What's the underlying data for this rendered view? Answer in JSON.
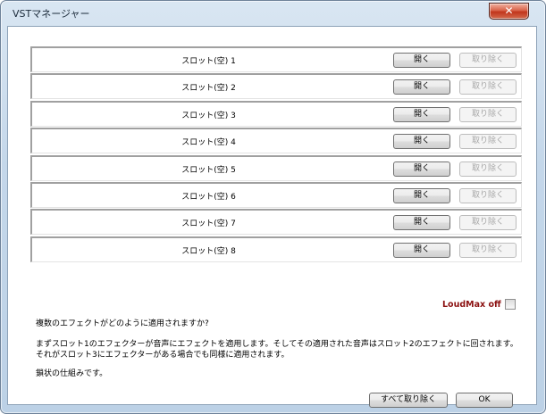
{
  "window": {
    "title": "VSTマネージャー",
    "close_glyph": "✕"
  },
  "slots": [
    {
      "label": "スロット(空) 1",
      "open": "開く",
      "remove": "取り除く"
    },
    {
      "label": "スロット(空) 2",
      "open": "開く",
      "remove": "取り除く"
    },
    {
      "label": "スロット(空) 3",
      "open": "開く",
      "remove": "取り除く"
    },
    {
      "label": "スロット(空) 4",
      "open": "開く",
      "remove": "取り除く"
    },
    {
      "label": "スロット(空) 5",
      "open": "開く",
      "remove": "取り除く"
    },
    {
      "label": "スロット(空) 6",
      "open": "開く",
      "remove": "取り除く"
    },
    {
      "label": "スロット(空) 7",
      "open": "開く",
      "remove": "取り除く"
    },
    {
      "label": "スロット(空) 8",
      "open": "開く",
      "remove": "取り除く"
    }
  ],
  "loudmax": {
    "label": "LoudMax off",
    "checked": false
  },
  "description": {
    "question": "複数のエフェクトがどのように適用されますか?",
    "line1": "まずスロット1のエフェクターが音声にエフェクトを適用します。そしてその適用された音声はスロット2のエフェクトに回されます。",
    "line2": "それがスロット3にエフェクターがある場合でも同様に適用されます。",
    "line3": "鎖状の仕組みです。"
  },
  "footer": {
    "remove_all": "すべて取り除く",
    "ok": "OK"
  }
}
